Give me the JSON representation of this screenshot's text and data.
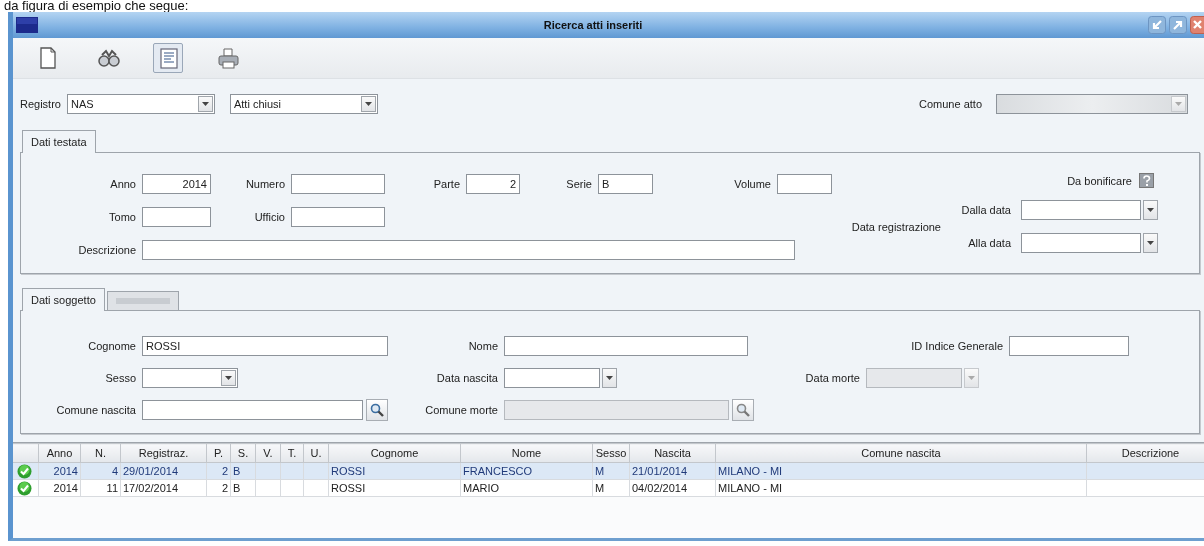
{
  "caption": "da figura di esempio che segue:",
  "window": {
    "title": "Ricerca atti inseriti"
  },
  "toolbar": [
    {
      "kind": "new",
      "selected": false
    },
    {
      "kind": "binoculars",
      "selected": false
    },
    {
      "kind": "form",
      "selected": true
    },
    {
      "kind": "print",
      "selected": false
    }
  ],
  "header_filters": [
    {
      "label": "Registro",
      "kind": "dropdown",
      "value": "NAS",
      "disabled": false
    },
    {
      "kind": "dropdown",
      "value": "Atti chiusi",
      "disabled": false
    },
    {
      "label": "Comune atto",
      "kind": "dropdown",
      "disabled": true
    }
  ],
  "testata_tabs": [
    {
      "label": "Dati testata",
      "selected": true,
      "disabled": false
    }
  ],
  "testata": {
    "rows": [
      [
        {
          "label": "Anno",
          "kind": "text",
          "value": "2014",
          "disabled": false
        },
        {
          "label": "Numero",
          "kind": "text",
          "disabled": false
        },
        {
          "label": "Parte",
          "kind": "text",
          "value": "2",
          "disabled": false
        },
        {
          "label": "Serie",
          "kind": "text",
          "value": "B",
          "disabled": false
        },
        {
          "label": "Volume",
          "kind": "text",
          "disabled": false
        }
      ],
      [
        {
          "label": "Tomo",
          "kind": "text",
          "disabled": false
        },
        {
          "label": "Ufficio",
          "kind": "text",
          "disabled": false
        }
      ],
      [
        {
          "label": "Descrizione",
          "kind": "text",
          "disabled": false
        }
      ]
    ],
    "da_bonificare": {
      "label": "Da bonificare",
      "indeterminate": true
    },
    "data_registrazione": {
      "label": "Data registrazione",
      "fields": [
        {
          "label": "Dalla data",
          "kind": "date",
          "disabled": false
        },
        {
          "label": "Alla data",
          "kind": "date",
          "disabled": false
        }
      ]
    }
  },
  "soggetto_tabs": [
    {
      "label": "Dati soggetto",
      "selected": true,
      "disabled": false
    },
    {
      "selected": false,
      "disabled": true
    }
  ],
  "soggetto": {
    "rows": [
      [
        {
          "label": "Cognome",
          "kind": "text",
          "value": "ROSSI",
          "disabled": false
        },
        {
          "label": "Nome",
          "kind": "text",
          "disabled": false
        },
        {
          "label": "ID Indice Generale",
          "kind": "text",
          "disabled": false
        }
      ],
      [
        {
          "label": "Sesso",
          "kind": "dropdown",
          "disabled": false
        },
        {
          "label": "Data nascita",
          "kind": "date",
          "disabled": false
        },
        {
          "label": "Data morte",
          "kind": "date",
          "disabled": true
        }
      ],
      [
        {
          "label": "Comune nascita",
          "kind": "lookup",
          "disabled": false
        },
        {
          "label": "Comune morte",
          "kind": "lookup",
          "disabled": true
        }
      ]
    ]
  },
  "table": {
    "columns": [
      "Anno",
      "N.",
      "Registraz.",
      "P.",
      "S.",
      "V.",
      "T.",
      "U.",
      "Cognome",
      "Nome",
      "Sesso",
      "Nascita",
      "Comune nascita",
      "Descrizione"
    ],
    "rows": [
      {
        "checked": true,
        "selected": true,
        "cells": [
          "2014",
          "4",
          "29/01/2014",
          "2",
          "B",
          null,
          null,
          null,
          "ROSSI",
          "FRANCESCO",
          "M",
          "21/01/2014",
          "MILANO - MI",
          null
        ]
      },
      {
        "checked": true,
        "selected": false,
        "cells": [
          "2014",
          "11",
          "17/02/2014",
          "2",
          "B",
          null,
          null,
          null,
          "ROSSI",
          "MARIO",
          "M",
          "04/02/2014",
          "MILANO - MI",
          null
        ]
      }
    ]
  }
}
